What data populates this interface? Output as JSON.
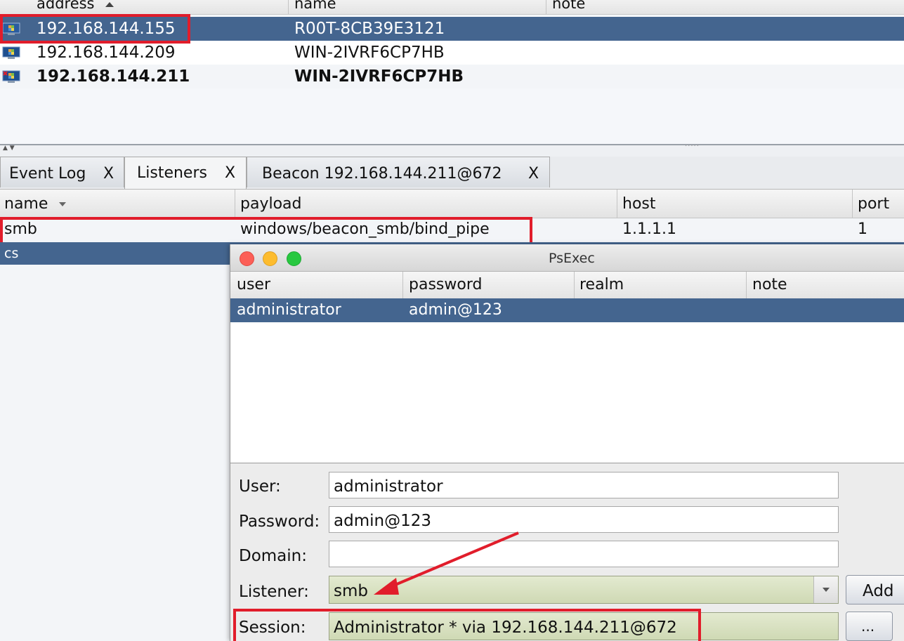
{
  "targets": {
    "columns": {
      "address": "address",
      "name": "name",
      "note": "note"
    },
    "sort_icon": "sort-ascending-icon",
    "rows": [
      {
        "address": "192.168.144.155",
        "name": "R00T-8CB39E3121",
        "note": ""
      },
      {
        "address": "192.168.144.209",
        "name": "WIN-2IVRF6CP7HB",
        "note": ""
      },
      {
        "address": "192.168.144.211",
        "name": "WIN-2IVRF6CP7HB",
        "note": ""
      }
    ]
  },
  "tabs": [
    {
      "label": "Event Log",
      "close": "X"
    },
    {
      "label": "Listeners",
      "close": "X"
    },
    {
      "label": "Beacon 192.168.144.211@672",
      "close": "X"
    }
  ],
  "listeners": {
    "columns": {
      "name": "name",
      "payload": "payload",
      "host": "host",
      "port": "port"
    },
    "rows": [
      {
        "name": "smb",
        "payload": "windows/beacon_smb/bind_pipe",
        "host": "1.1.1.1",
        "port": "1"
      },
      {
        "name": "cs",
        "payload": "",
        "host": "",
        "port": ""
      }
    ]
  },
  "dialog": {
    "title": "PsExec",
    "cred_columns": {
      "user": "user",
      "password": "password",
      "realm": "realm",
      "note": "note"
    },
    "cred_rows": [
      {
        "user": "administrator",
        "password": "admin@123",
        "realm": "",
        "note": ""
      }
    ],
    "form": {
      "user_label": "User:",
      "user_value": "administrator",
      "password_label": "Password:",
      "password_value": "admin@123",
      "domain_label": "Domain:",
      "domain_value": "",
      "listener_label": "Listener:",
      "listener_value": "smb",
      "add_label": "Add",
      "session_label": "Session:",
      "session_value": "Administrator * via  192.168.144.211@672",
      "browse_label": "..."
    }
  },
  "colors": {
    "selection": "#44658f",
    "highlight_box": "#e11d2b",
    "arrow": "#e11d2b",
    "combo": "#cfd9b4"
  }
}
